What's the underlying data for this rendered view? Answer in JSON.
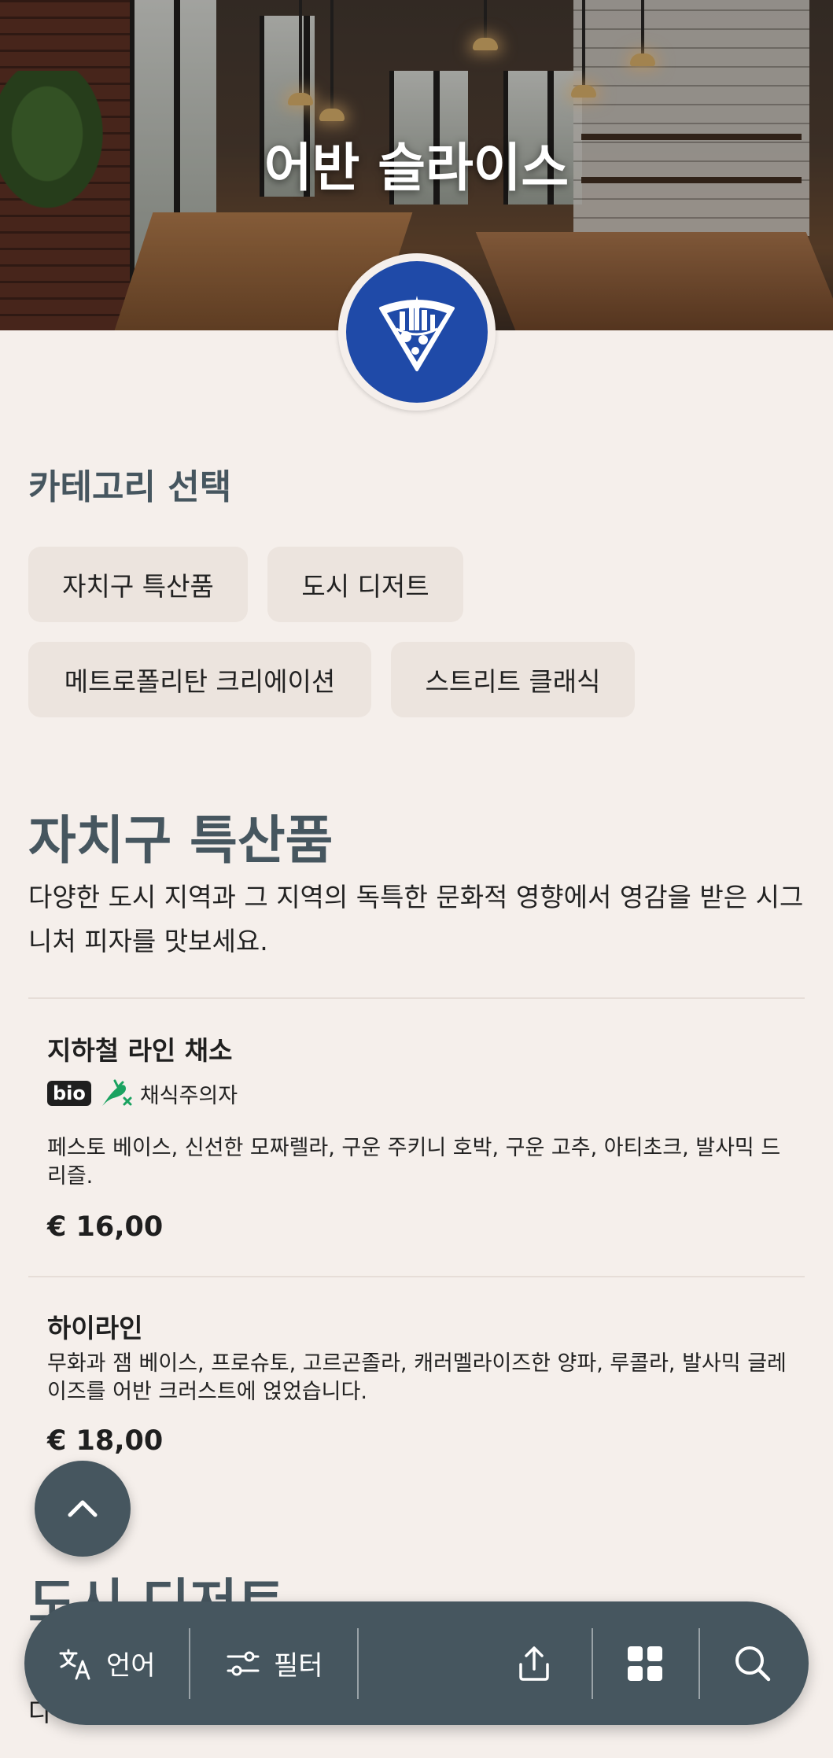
{
  "restaurant": {
    "name": "어반 슬라이스",
    "brand_color": "#1f4aa8"
  },
  "categories": {
    "title": "카테고리 선택",
    "items": [
      "자치구 특산품",
      "도시 디저트",
      "메트로폴리탄 크리에이션",
      "스트리트 클래식"
    ]
  },
  "sections": [
    {
      "title": "자치구 특산품",
      "description": "다양한 도시 지역과 그 지역의 독특한 문화적 영향에서 영감을 받은 시그니처 피자를 맛보세요.",
      "items": [
        {
          "name": "지하철 라인 채소",
          "badge": "bio",
          "diet_icon": "vegetarian-icon",
          "diet_label": "채식주의자",
          "description": "페스토 베이스, 신선한 모짜렐라, 구운 주키니 호박, 구운 고추, 아티초크, 발사믹 드리즐.",
          "price": "€ 16,00"
        },
        {
          "name": "하이라인",
          "description": "무화과 잼 베이스, 프로슈토, 고르곤졸라, 캐러멜라이즈한 양파, 루콜라, 발사믹 글레이즈를 어반 크러스트에 얹었습니다.",
          "price": "€ 18,00"
        }
      ]
    },
    {
      "title": "도시 디저트"
    }
  ],
  "nav": {
    "language_label": "언어",
    "filter_label": "필터",
    "icons": [
      "translate-icon",
      "filter-icon",
      "share-icon",
      "grid-icon",
      "search-icon"
    ]
  },
  "colors": {
    "background": "#f5efeb",
    "accent": "#46565f",
    "chip": "#ece4de",
    "veg_green": "#1aa260"
  }
}
